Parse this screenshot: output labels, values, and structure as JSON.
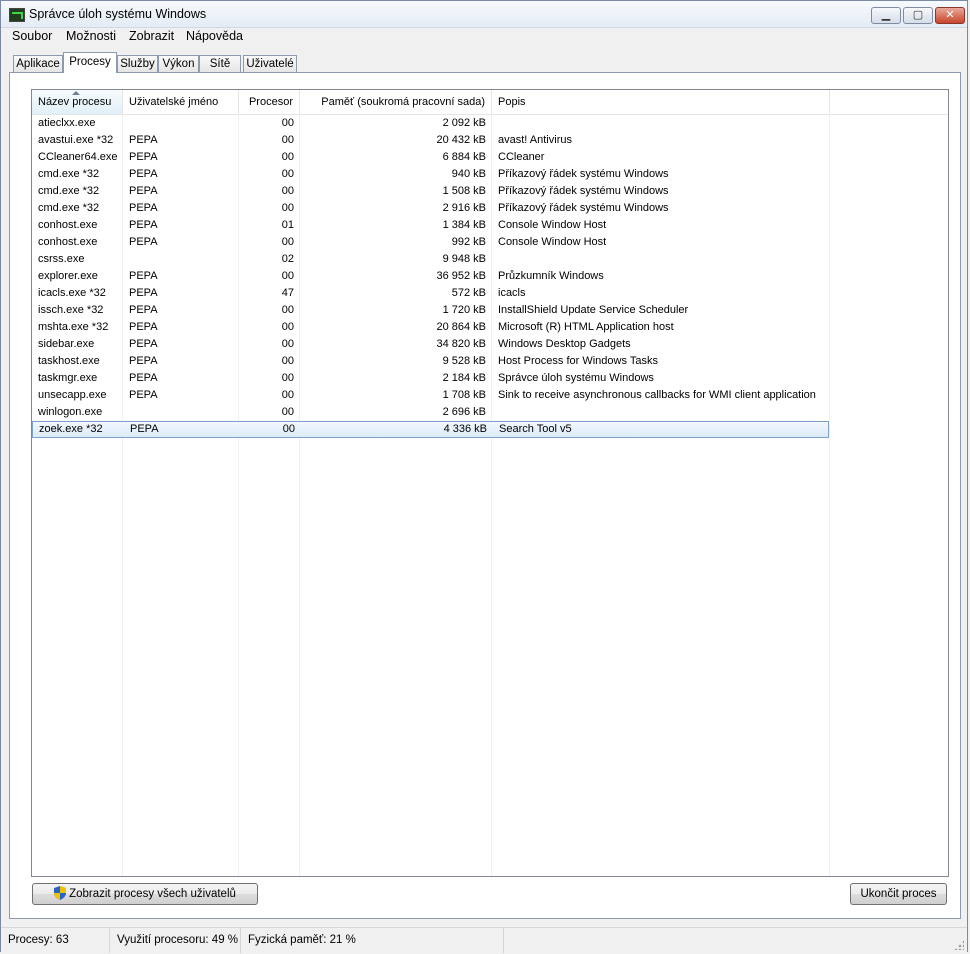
{
  "window": {
    "title": "Správce úloh systému Windows",
    "controls": {
      "minimize": "▁",
      "maximize": "▢",
      "close": "✕"
    }
  },
  "menu": [
    "Soubor",
    "Možnosti",
    "Zobrazit",
    "Nápověda"
  ],
  "tabs": [
    {
      "label": "Aplikace",
      "active": false
    },
    {
      "label": "Procesy",
      "active": true
    },
    {
      "label": "Služby",
      "active": false
    },
    {
      "label": "Výkon",
      "active": false
    },
    {
      "label": "Sítě",
      "active": false
    },
    {
      "label": "Uživatelé",
      "active": false
    }
  ],
  "table": {
    "columns": [
      "Název procesu",
      "Uživatelské jméno",
      "Procesor",
      "Paměť (soukromá pracovní sada)",
      "Popis"
    ],
    "sorted_column": "Název procesu",
    "rows": [
      [
        "atieclxx.exe",
        "",
        "00",
        "2 092 kB",
        ""
      ],
      [
        "avastui.exe *32",
        "PEPA",
        "00",
        "20 432 kB",
        "avast! Antivirus"
      ],
      [
        "CCleaner64.exe",
        "PEPA",
        "00",
        "6 884 kB",
        "CCleaner"
      ],
      [
        "cmd.exe *32",
        "PEPA",
        "00",
        "940 kB",
        "Příkazový řádek systému Windows"
      ],
      [
        "cmd.exe *32",
        "PEPA",
        "00",
        "1 508 kB",
        "Příkazový řádek systému Windows"
      ],
      [
        "cmd.exe *32",
        "PEPA",
        "00",
        "2 916 kB",
        "Příkazový řádek systému Windows"
      ],
      [
        "conhost.exe",
        "PEPA",
        "01",
        "1 384 kB",
        "Console Window Host"
      ],
      [
        "conhost.exe",
        "PEPA",
        "00",
        "992 kB",
        "Console Window Host"
      ],
      [
        "csrss.exe",
        "",
        "02",
        "9 948 kB",
        ""
      ],
      [
        "explorer.exe",
        "PEPA",
        "00",
        "36 952 kB",
        "Průzkumník Windows"
      ],
      [
        "icacls.exe *32",
        "PEPA",
        "47",
        "572 kB",
        "icacls"
      ],
      [
        "issch.exe *32",
        "PEPA",
        "00",
        "1 720 kB",
        "InstallShield Update Service Scheduler"
      ],
      [
        "mshta.exe *32",
        "PEPA",
        "00",
        "20 864 kB",
        "Microsoft (R) HTML Application host"
      ],
      [
        "sidebar.exe",
        "PEPA",
        "00",
        "34 820 kB",
        "Windows Desktop Gadgets"
      ],
      [
        "taskhost.exe",
        "PEPA",
        "00",
        "9 528 kB",
        "Host Process for Windows Tasks"
      ],
      [
        "taskmgr.exe",
        "PEPA",
        "00",
        "2 184 kB",
        "Správce úloh systému Windows"
      ],
      [
        "unsecapp.exe",
        "PEPA",
        "00",
        "1 708 kB",
        "Sink to receive asynchronous callbacks for WMI client application"
      ],
      [
        "winlogon.exe",
        "",
        "00",
        "2 696 kB",
        ""
      ],
      [
        "zoek.exe *32",
        "PEPA",
        "00",
        "4 336 kB",
        "Search Tool v5"
      ]
    ],
    "selected_row": 18
  },
  "buttons": {
    "show_all": "Zobrazit procesy všech uživatelů",
    "end_process": "Ukončit proces"
  },
  "status": {
    "processes": "Procesy: 63",
    "cpu": "Využití procesoru: 49 %",
    "memory": "Fyzická paměť: 21 %"
  }
}
